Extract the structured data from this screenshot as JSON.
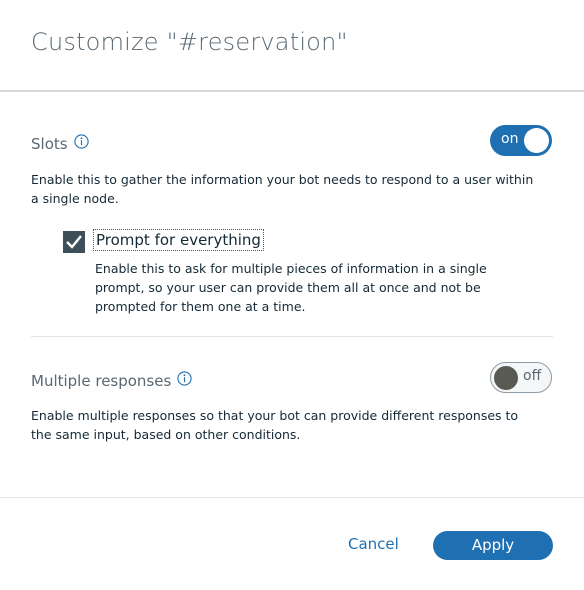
{
  "dialog": {
    "title": "Customize \"#reservation\""
  },
  "slots": {
    "heading": "Slots",
    "toggle_label": "on",
    "toggle_state": "on",
    "description_line1": "Enable this to gather the information your bot needs to respond to a user within",
    "description_line2": "a single node.",
    "prompt_option": {
      "label": "Prompt for everything",
      "checked": true,
      "description_line1": "Enable this to ask for multiple pieces of information in a single",
      "description_line2": "prompt, so your user can provide them all at once and not be",
      "description_line3": "prompted for them one at a time."
    }
  },
  "multiple_responses": {
    "heading": "Multiple responses",
    "toggle_label": "off",
    "toggle_state": "off",
    "description_line1": "Enable multiple responses so that your bot can provide different responses to",
    "description_line2": "the same input, based on other conditions."
  },
  "footer": {
    "cancel_label": "Cancel",
    "apply_label": "Apply"
  },
  "colors": {
    "accent": "#1f6fb3",
    "toggle_off_knob": "#5a5a55",
    "checkbox_fill": "#3d4f59"
  }
}
